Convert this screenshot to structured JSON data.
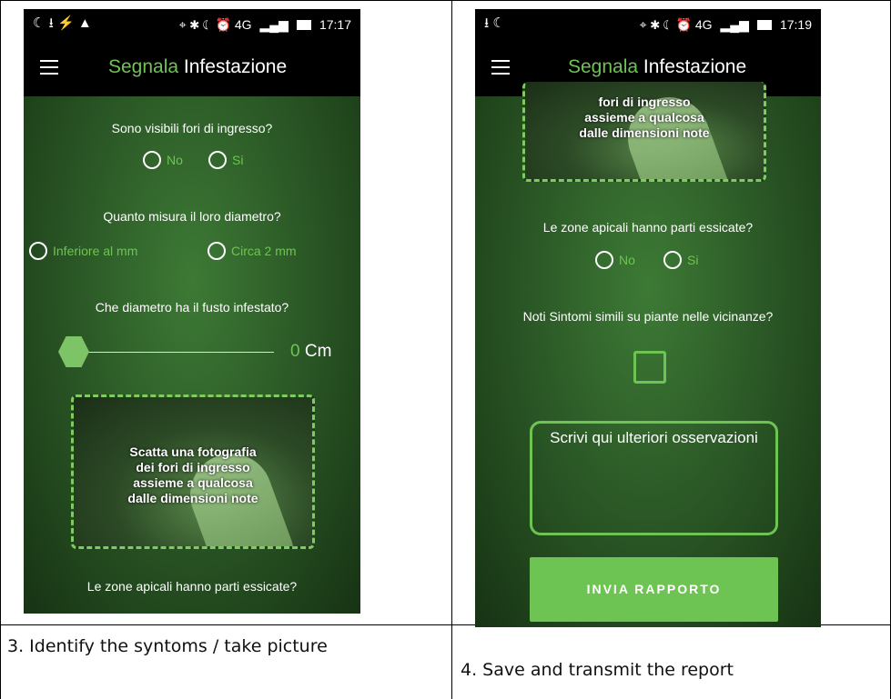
{
  "left": {
    "status": {
      "left_icons": "☾ ⭳ ⚡ ▲",
      "right_icons": "⌖ ✱ ☾ ⏰ 4G",
      "time": "17:17"
    },
    "title": {
      "accent": "Segnala",
      "rest": " Infestazione"
    },
    "q1": "Sono visibili fori di ingresso?",
    "q1_options": [
      "No",
      "Si"
    ],
    "q2": "Quanto misura il loro diametro?",
    "q2_options": [
      "Inferiore al mm",
      "Circa 2 mm"
    ],
    "q3": "Che diametro ha il fusto infestato?",
    "slider": {
      "value": "0",
      "unit": " Cm"
    },
    "photo_text": "Scatta una fotografia dei fori di ingresso assieme a qualcosa dalle dimensioni note",
    "q4": "Le zone apicali hanno parti essicate?"
  },
  "right": {
    "status": {
      "left_icons": "⭳ ☾",
      "right_icons": "⌖ ✱ ☾ ⏰ 4G",
      "time": "17:19"
    },
    "title": {
      "accent": "Segnala",
      "rest": " Infestazione"
    },
    "photo_text": "fori di ingresso assieme a qualcosa dalle dimensioni note",
    "q4": "Le zone apicali hanno parti essicate?",
    "q4_options": [
      "No",
      "Si"
    ],
    "q5": "Noti Sintomi simili su piante nelle vicinanze?",
    "textarea_placeholder": "Scrivi qui ulteriori osservazioni",
    "submit_label": "INVIA RAPPORTO"
  },
  "captions": {
    "left": "3. Identify the syntoms / take picture",
    "right": "4. Save and transmit the report"
  }
}
